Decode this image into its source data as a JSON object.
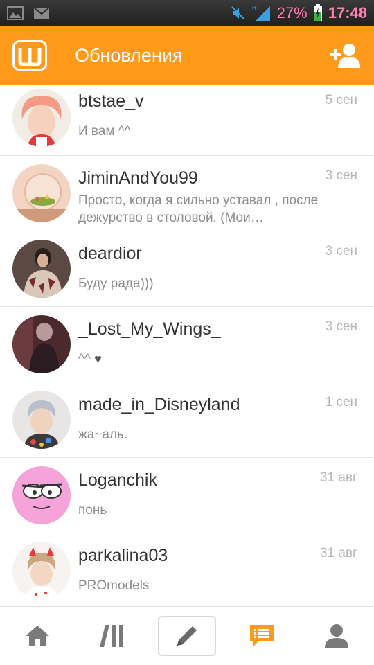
{
  "status_bar": {
    "battery": "27%",
    "time": "17:48",
    "icons": [
      "gallery-icon",
      "mail-icon",
      "mute-icon",
      "signal-icon",
      "battery-charging-icon"
    ]
  },
  "header": {
    "title": "Обновления",
    "logo_icon": "app-logo-icon",
    "action_icon": "add-user-icon",
    "accent": "#ff9a1a"
  },
  "conversations": [
    {
      "username": "btstae_v",
      "time": "5 сен",
      "message": "И вам ^^"
    },
    {
      "username": "JiminAndYou99",
      "time": "3 сен",
      "message": "Просто, когда я сильно уставал , после дежурство в столовой. (Мои…"
    },
    {
      "username": "deardior",
      "time": "3 сен",
      "message": "Буду рада)))"
    },
    {
      "username": "_Lost_My_Wings_",
      "time": "3 сен",
      "message": "^^"
    },
    {
      "username": "made_in_Disneyland",
      "time": "1 сен",
      "message": "жа~аль."
    },
    {
      "username": "Loganchik",
      "time": "31 авг",
      "message": "понь"
    },
    {
      "username": "parkalina03",
      "time": "31 авг",
      "message": "PROmodels"
    }
  ],
  "bottom_nav": {
    "items": [
      "home-icon",
      "library-icon",
      "compose-icon",
      "messages-icon",
      "profile-icon"
    ],
    "active": "messages-icon"
  }
}
